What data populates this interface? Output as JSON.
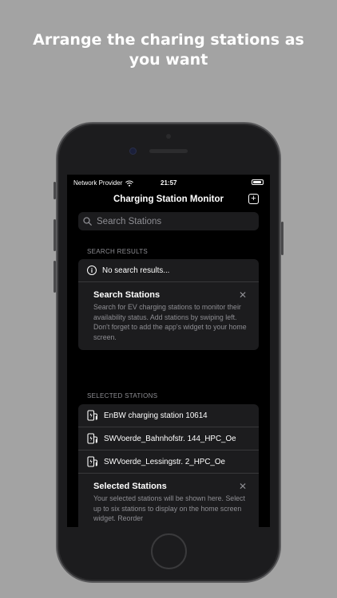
{
  "headline": "Arrange the charing stations as you want",
  "status_bar": {
    "carrier": "Network Provider",
    "time": "21:57"
  },
  "navbar": {
    "title": "Charging Station Monitor",
    "add_icon": "plus-square-icon"
  },
  "search": {
    "placeholder": "Search Stations",
    "icon": "search-icon"
  },
  "search_results": {
    "header": "SEARCH RESULTS",
    "empty_text": "No search results...",
    "info_title": "Search Stations",
    "info_body": "Search for EV charging stations to monitor their availability status. Add stations by swiping left. Don't forget to add the app's widget to your home screen."
  },
  "selected": {
    "header": "SELECTED STATIONS",
    "stations": [
      {
        "name": "EnBW charging station 10614"
      },
      {
        "name": "SWVoerde_Bahnhofstr. 144_HPC_Oe"
      },
      {
        "name": "SWVoerde_Lessingstr. 2_HPC_Oe"
      }
    ],
    "info_title": "Selected Stations",
    "info_body": "Your selected stations will be shown here. Select up to six stations to display on the home screen widget. Reorder"
  },
  "colors": {
    "background": "#a3a3a3",
    "screen": "#000000",
    "card": "#1c1c1e",
    "secondary_text": "#8e8e93"
  }
}
